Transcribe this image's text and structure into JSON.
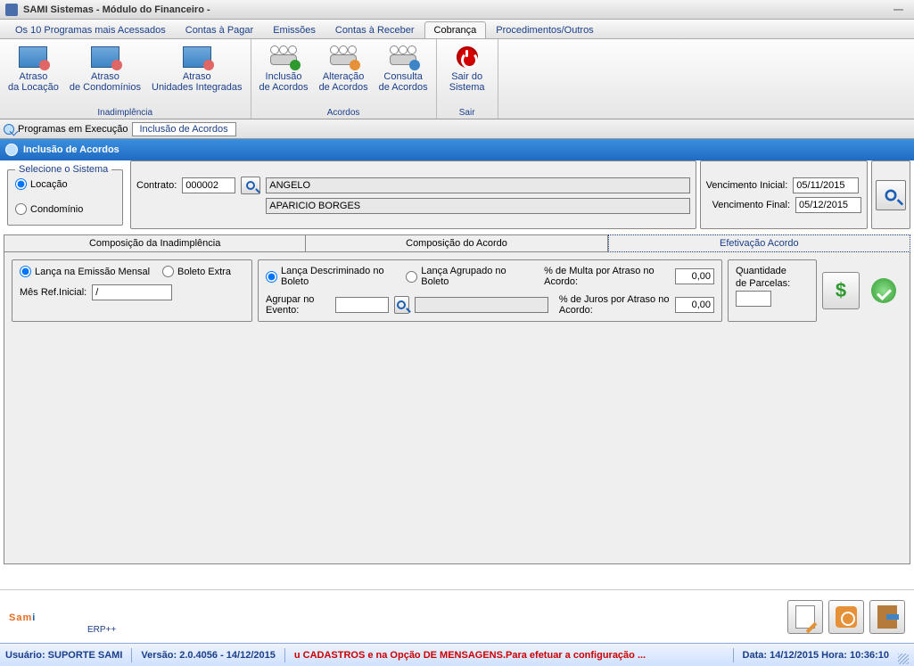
{
  "window": {
    "title": "SAMI Sistemas - Módulo do Financeiro -"
  },
  "menu": {
    "items": [
      "Os 10 Programas mais Acessados",
      "Contas à Pagar",
      "Emissões",
      "Contas à Receber",
      "Cobrança",
      "Procedimentos/Outros"
    ],
    "active": 4
  },
  "ribbon": {
    "groups": [
      {
        "title": "Inadimplência",
        "buttons": [
          {
            "label": "Atraso\nda Locação"
          },
          {
            "label": "Atraso\nde Condomínios"
          },
          {
            "label": "Atraso\nUnidades Integradas"
          }
        ]
      },
      {
        "title": "Acordos",
        "buttons": [
          {
            "label": "Inclusão\nde Acordos"
          },
          {
            "label": "Alteração\nde Acordos"
          },
          {
            "label": "Consulta\nde Acordos"
          }
        ]
      },
      {
        "title": "Sair",
        "buttons": [
          {
            "label": "Sair do\nSistema"
          }
        ]
      }
    ]
  },
  "docTabs": {
    "label1": "Programas em Execução",
    "label2": "Inclusão de Acordos"
  },
  "page": {
    "title": "Inclusão de Acordos"
  },
  "sistema": {
    "legend": "Selecione o Sistema",
    "opt1": "Locação",
    "opt2": "Condomínio",
    "contratoLabel": "Contrato:",
    "contratoNum": "000002",
    "nome1": "ANGELO",
    "nome2": "APARICIO BORGES"
  },
  "venc": {
    "l1": "Vencimento Inicial:",
    "v1": "05/11/2015",
    "l2": "Vencimento Final:",
    "v2": "05/12/2015"
  },
  "tabs": {
    "t1": "Composição da Inadimplência",
    "t2": "Composição do Acordo",
    "t3": "Efetivação Acordo"
  },
  "efet": {
    "r1": "Lança na Emissão Mensal",
    "r2": "Boleto Extra",
    "mesLabel": "Mês Ref.Inicial:",
    "mesVal": "/",
    "r3": "Lança Descriminado no Boleto",
    "r4": "Lança Agrupado no Boleto",
    "agruparLabel": "Agrupar no Evento:",
    "multaLabel": "% de Multa por Atraso no Acordo:",
    "multaVal": "0,00",
    "jurosLabel": "% de Juros por Atraso no Acordo:",
    "jurosVal": "0,00",
    "qtdLabel1": "Quantidade",
    "qtdLabel2": "de Parcelas:"
  },
  "logo": {
    "text": "Sami",
    "sub": "ERP++"
  },
  "status": {
    "user": "Usuário: SUPORTE SAMI",
    "ver": "Versão: 2.0.4056 - 14/12/2015",
    "alert": "u CADASTROS e na Opção DE MENSAGENS.Para efetuar a configuração ...",
    "dt": "Data: 14/12/2015 Hora: 10:36:10"
  }
}
